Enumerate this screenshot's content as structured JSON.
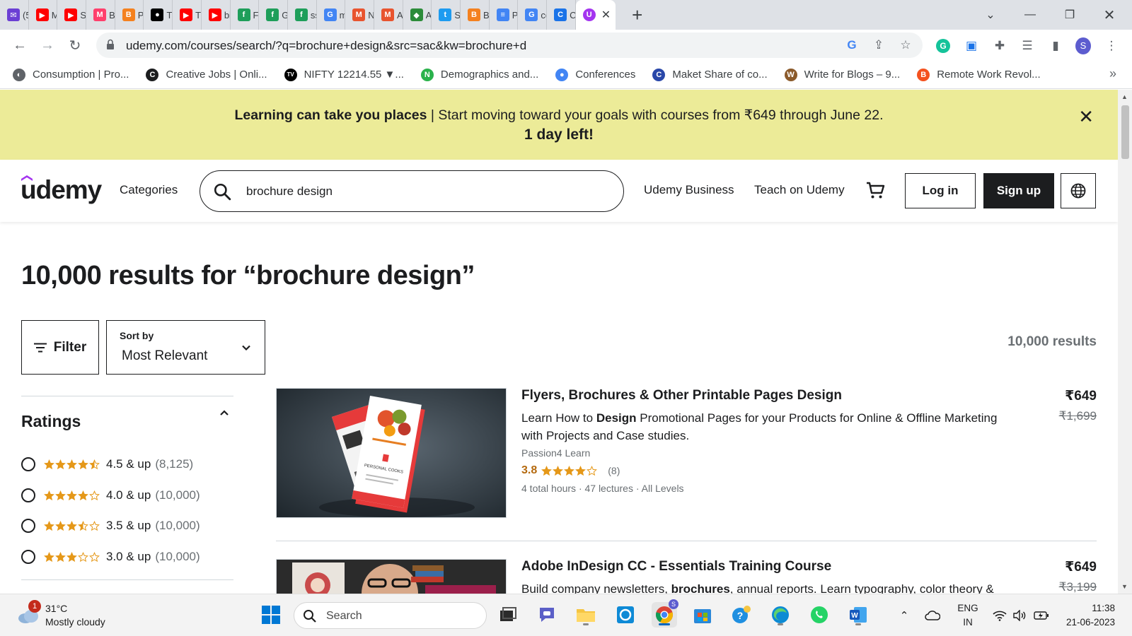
{
  "browser": {
    "tabs": [
      {
        "label": "(5",
        "color": "#6b3fd4",
        "glyph": "✉"
      },
      {
        "label": "M",
        "color": "#ff0000",
        "glyph": "▶"
      },
      {
        "label": "Sc",
        "color": "#ff0000",
        "glyph": "▶"
      },
      {
        "label": "Br",
        "color": "#ff3f6c",
        "glyph": "M"
      },
      {
        "label": "Pc",
        "color": "#f4811f",
        "glyph": "B"
      },
      {
        "label": "Tl",
        "color": "#000000",
        "glyph": "●"
      },
      {
        "label": "Tl",
        "color": "#ff0000",
        "glyph": "▶"
      },
      {
        "label": "bi",
        "color": "#ff0000",
        "glyph": "▶"
      },
      {
        "label": "Fi",
        "color": "#1e9e5a",
        "glyph": "f"
      },
      {
        "label": "G",
        "color": "#1e9e5a",
        "glyph": "f"
      },
      {
        "label": "ss",
        "color": "#1e9e5a",
        "glyph": "f"
      },
      {
        "label": "m",
        "color": "#4285f4",
        "glyph": "G"
      },
      {
        "label": "N",
        "color": "#e8542f",
        "glyph": "M"
      },
      {
        "label": "A",
        "color": "#e8542f",
        "glyph": "M"
      },
      {
        "label": "A",
        "color": "#2c8c3a",
        "glyph": "◆"
      },
      {
        "label": "S",
        "color": "#1d9bf0",
        "glyph": "t"
      },
      {
        "label": "B",
        "color": "#f4811f",
        "glyph": "B"
      },
      {
        "label": "P",
        "color": "#4285f4",
        "glyph": "≡"
      },
      {
        "label": "cc",
        "color": "#4285f4",
        "glyph": "G"
      },
      {
        "label": "C",
        "color": "#1a73e8",
        "glyph": "C"
      }
    ],
    "active_tab_glyph": "U",
    "url": "udemy.com/courses/search/?q=brochure+design&src=sac&kw=brochure+d",
    "bookmarks": [
      {
        "label": "Consumption | Pro...",
        "color": "#5f6368",
        "glyph": "◐"
      },
      {
        "label": "Creative Jobs | Onli...",
        "color": "#1c1d1f",
        "glyph": "C"
      },
      {
        "label": "NIFTY 12214.55 ▼...",
        "color": "#000000",
        "glyph": "TV"
      },
      {
        "label": "Demographics and...",
        "color": "#2bb24c",
        "glyph": "N"
      },
      {
        "label": "Conferences",
        "color": "#4285f4",
        "glyph": "●"
      },
      {
        "label": "Maket Share of co...",
        "color": "#2947a9",
        "glyph": "C"
      },
      {
        "label": "Write for Blogs – 9...",
        "color": "#8b5a2b",
        "glyph": "W"
      },
      {
        "label": "Remote Work Revol...",
        "color": "#f4511e",
        "glyph": "B"
      }
    ],
    "bookmarks_more": "»"
  },
  "promo": {
    "bold_text": "Learning can take you places",
    "text": " | Start moving toward your goals with courses from ₹649 through June 22.",
    "countdown": "1 day left!"
  },
  "header": {
    "logo": "udemy",
    "categories": "Categories",
    "search_value": "brochure design",
    "business": "Udemy Business",
    "teach": "Teach on Udemy",
    "login": "Log in",
    "signup": "Sign up"
  },
  "results": {
    "title": "10,000 results for “brochure design”",
    "filter_label": "Filter",
    "sort_label": "Sort by",
    "sort_value": "Most Relevant",
    "count": "10,000 results"
  },
  "ratings_filter": {
    "title": "Ratings",
    "options": [
      {
        "label": "4.5 & up",
        "count": "(8,125)",
        "stars": 4.5
      },
      {
        "label": "4.0 & up",
        "count": "(10,000)",
        "stars": 4.0
      },
      {
        "label": "3.5 & up",
        "count": "(10,000)",
        "stars": 3.5
      },
      {
        "label": "3.0 & up",
        "count": "(10,000)",
        "stars": 3.0
      }
    ]
  },
  "courses": [
    {
      "title": "Flyers, Brochures & Other Printable Pages Design",
      "desc_pre": "Learn How to ",
      "desc_bold": "Design",
      "desc_post": " Promotional Pages for your Products for Online & Offline Marketing with Projects and Case studies.",
      "instructor": "Passion4 Learn",
      "rating": "3.8",
      "stars": 3.8,
      "rating_count": "(8)",
      "meta": "4 total hours · 47 lectures · All Levels",
      "price": "₹649",
      "old_price": "₹1,699",
      "thumb_text": "PERSONAL COOKS"
    },
    {
      "title": "Adobe InDesign CC - Essentials Training Course",
      "desc_pre": "Build company newsletters, ",
      "desc_bold": "brochures",
      "desc_post": ", annual reports. Learn typography, color theory &",
      "price": "₹649",
      "old_price": "₹3,199"
    }
  ],
  "taskbar": {
    "weather_badge": "1",
    "temperature": "31°C",
    "condition": "Mostly cloudy",
    "search_label": "Search",
    "lang_line1": "ENG",
    "lang_line2": "IN",
    "time": "11:38",
    "date": "21-06-2023",
    "profile_initial": "S",
    "chrome_profile_initial": "S"
  },
  "colors": {
    "promo_bg": "#eceb98",
    "rating_orange": "#b4690e",
    "star": "#e59819",
    "udemy_purple": "#a435f0"
  }
}
